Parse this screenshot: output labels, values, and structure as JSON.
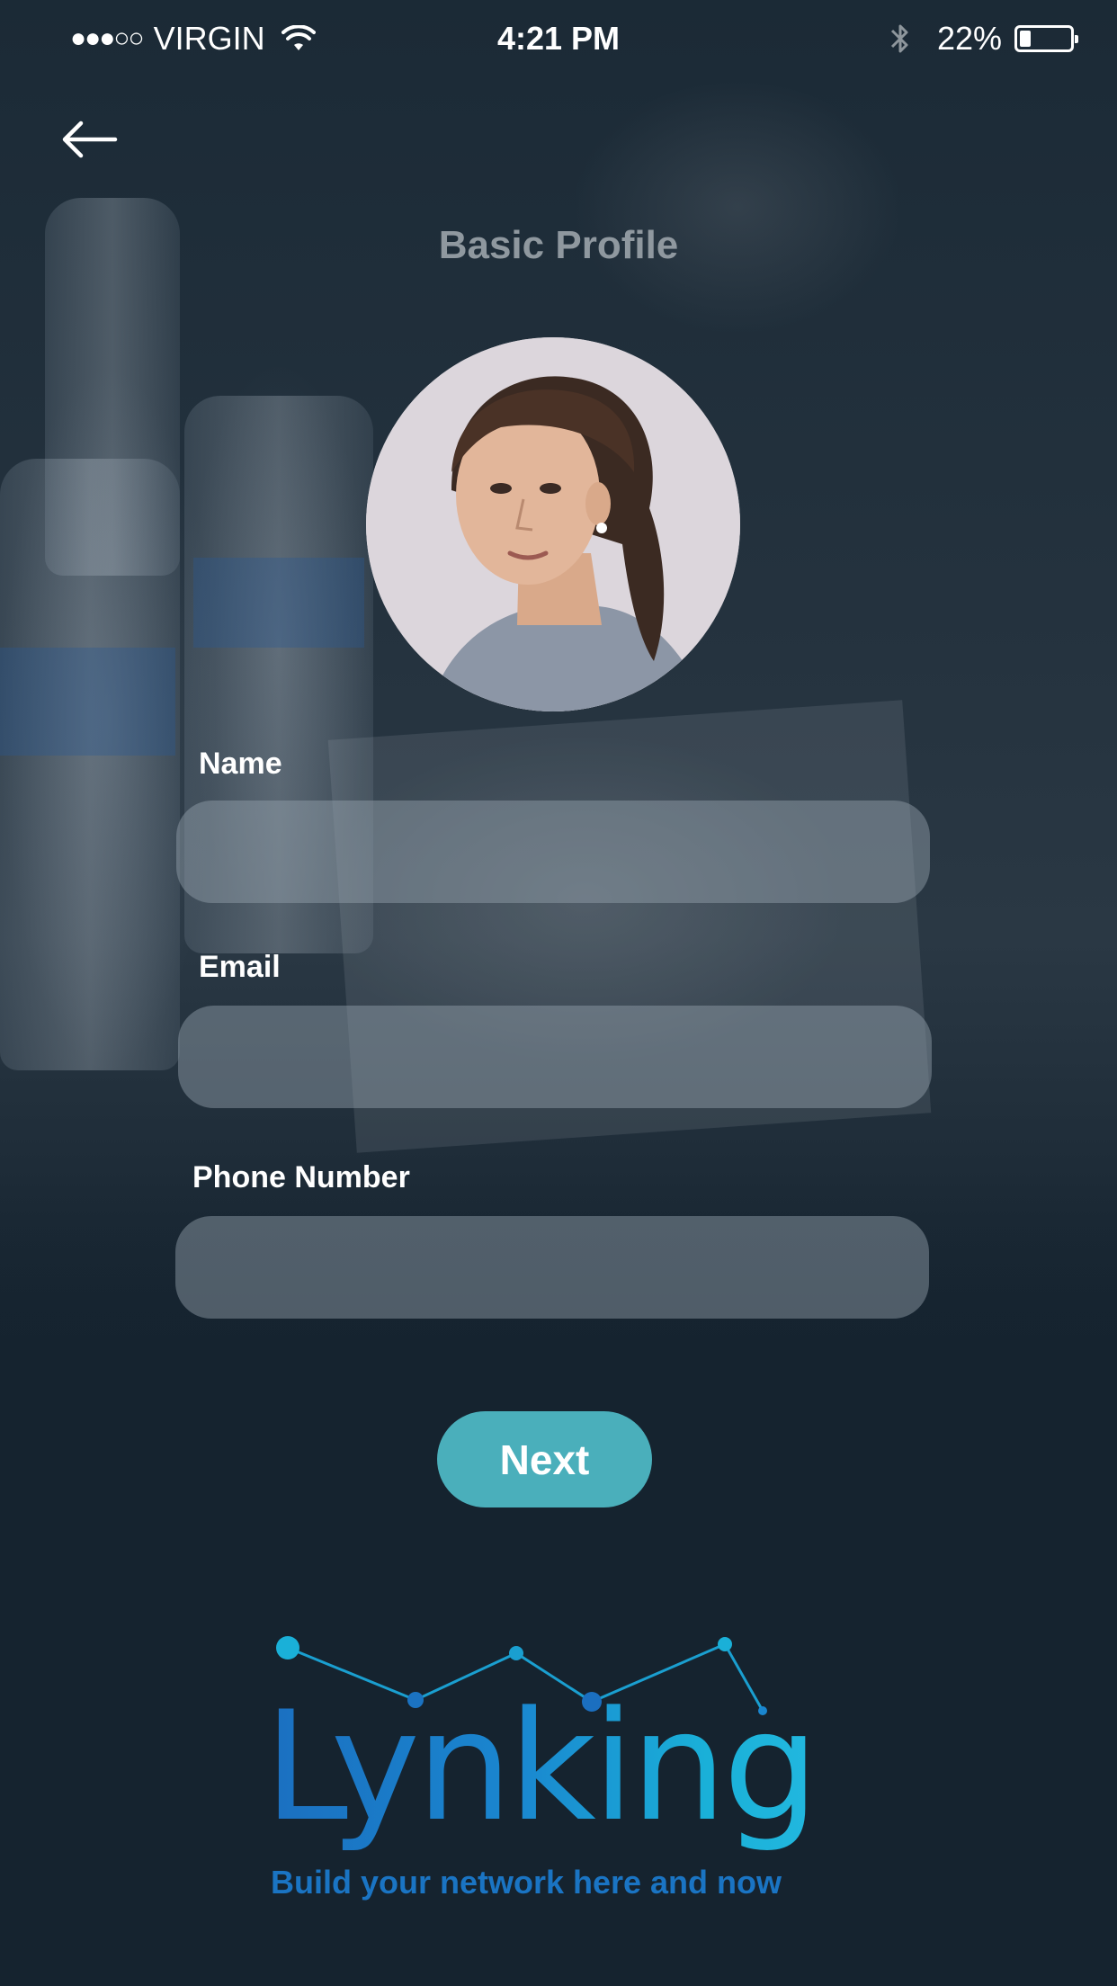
{
  "status_bar": {
    "signal": "●●●○○",
    "carrier": "VIRGIN",
    "time": "4:21 PM",
    "battery_percent": "22%",
    "battery_level": 0.22
  },
  "header": {
    "back_icon": "arrow-left-icon",
    "title": "Basic Profile"
  },
  "form": {
    "name_label": "Name",
    "name_value": "",
    "email_label": "Email",
    "email_value": "",
    "phone_label": "Phone Number",
    "phone_value": ""
  },
  "actions": {
    "next_label": "Next"
  },
  "brand": {
    "wordmark": "Lynking",
    "tagline": "Build your network here and now"
  },
  "colors": {
    "accent": "#4aafbb",
    "brand_blue": "#1a74c3",
    "brand_cyan": "#1ab0d8",
    "background": "#15232f"
  }
}
